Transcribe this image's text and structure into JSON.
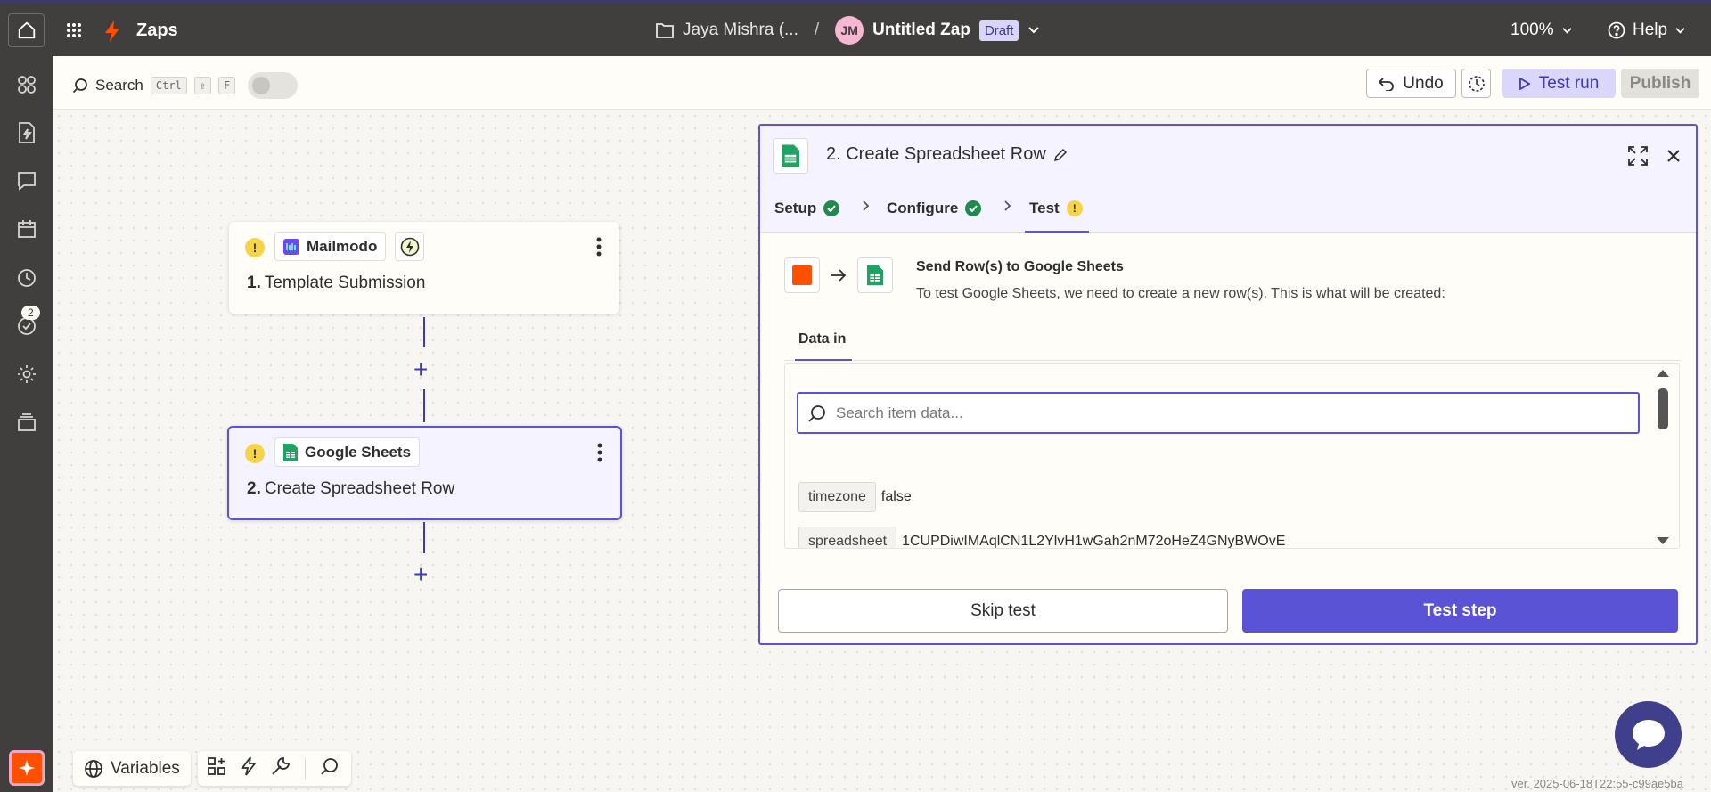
{
  "topbar": {
    "app_name": "Zaps",
    "folder": "Jaya Mishra (...",
    "separator": "/",
    "avatar_initials": "JM",
    "zap_title": "Untitled Zap",
    "status_badge": "Draft",
    "zoom": "100%",
    "help": "Help"
  },
  "rail": {
    "badge_count": "2"
  },
  "toolbar": {
    "search_label": "Search",
    "kbd_ctrl": "Ctrl",
    "kbd_shift": "⇧",
    "kbd_f": "F",
    "undo_label": "Undo",
    "test_run_label": "Test run",
    "publish_label": "Publish"
  },
  "canvas": {
    "nodes": [
      {
        "app": "Mailmodo",
        "number": "1.",
        "title": "Template Submission",
        "warn": "!"
      },
      {
        "app": "Google Sheets",
        "number": "2.",
        "title": "Create Spreadsheet Row",
        "warn": "!"
      }
    ],
    "plus": "+"
  },
  "panel": {
    "title": "2. Create Spreadsheet Row",
    "tabs": [
      {
        "label": "Setup",
        "status": "complete"
      },
      {
        "label": "Configure",
        "status": "complete"
      },
      {
        "label": "Test",
        "status": "warning"
      }
    ],
    "tab_warn": "!",
    "send_title": "Send Row(s) to Google Sheets",
    "send_desc": "To test Google Sheets, we need to create a new row(s). This is what will be created:",
    "data_in_tab": "Data in",
    "search_placeholder": "Search item data...",
    "items": [
      {
        "key": "timezone",
        "value": "false"
      },
      {
        "key": "spreadsheet",
        "value": "1CUPDiwIMAqlCN1L2YlvH1wGah2nM72oHeZ4GNyBWOvE"
      }
    ],
    "skip_label": "Skip test",
    "test_label": "Test step"
  },
  "bottom": {
    "variables_label": "Variables",
    "version": "ver. 2025-06-18T22:55-c99ae5ba"
  },
  "colors": {
    "brand_orange": "#ff4f00",
    "accent_purple": "#5b53d6",
    "topbar": "#403f3e",
    "success": "#1f8a4c",
    "warning": "#f5d547"
  }
}
